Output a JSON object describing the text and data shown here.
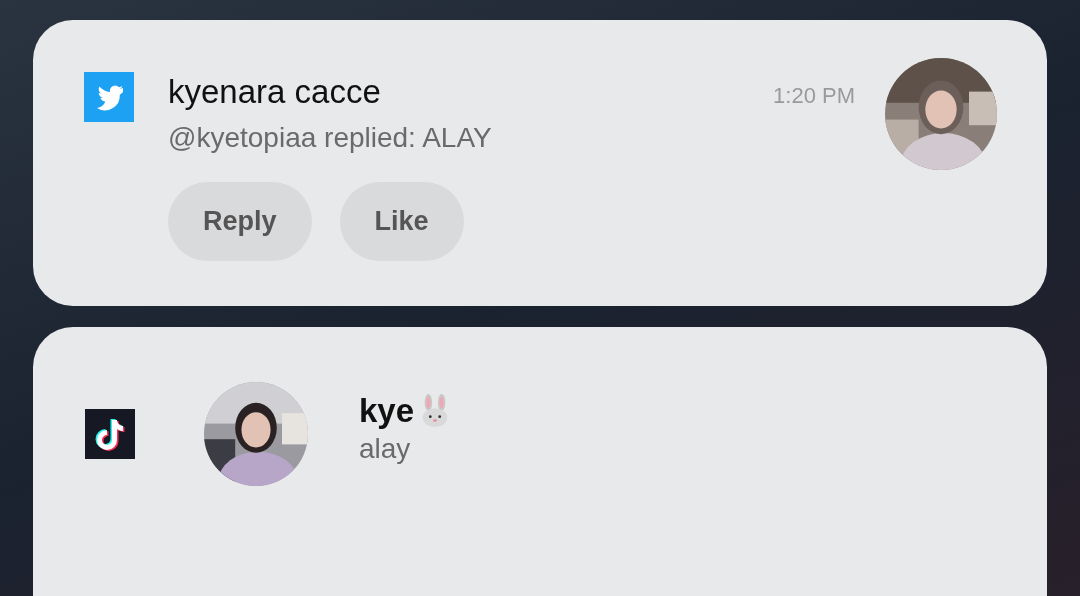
{
  "notifications": [
    {
      "kind": "twitter",
      "title": "kyenara cacce",
      "time": "1:20 PM",
      "text": "@kyetopiaa replied: ALAY",
      "actions": [
        "Reply",
        "Like"
      ]
    },
    {
      "kind": "tiktok",
      "title": "kye",
      "badge": true,
      "text": "alay"
    }
  ]
}
